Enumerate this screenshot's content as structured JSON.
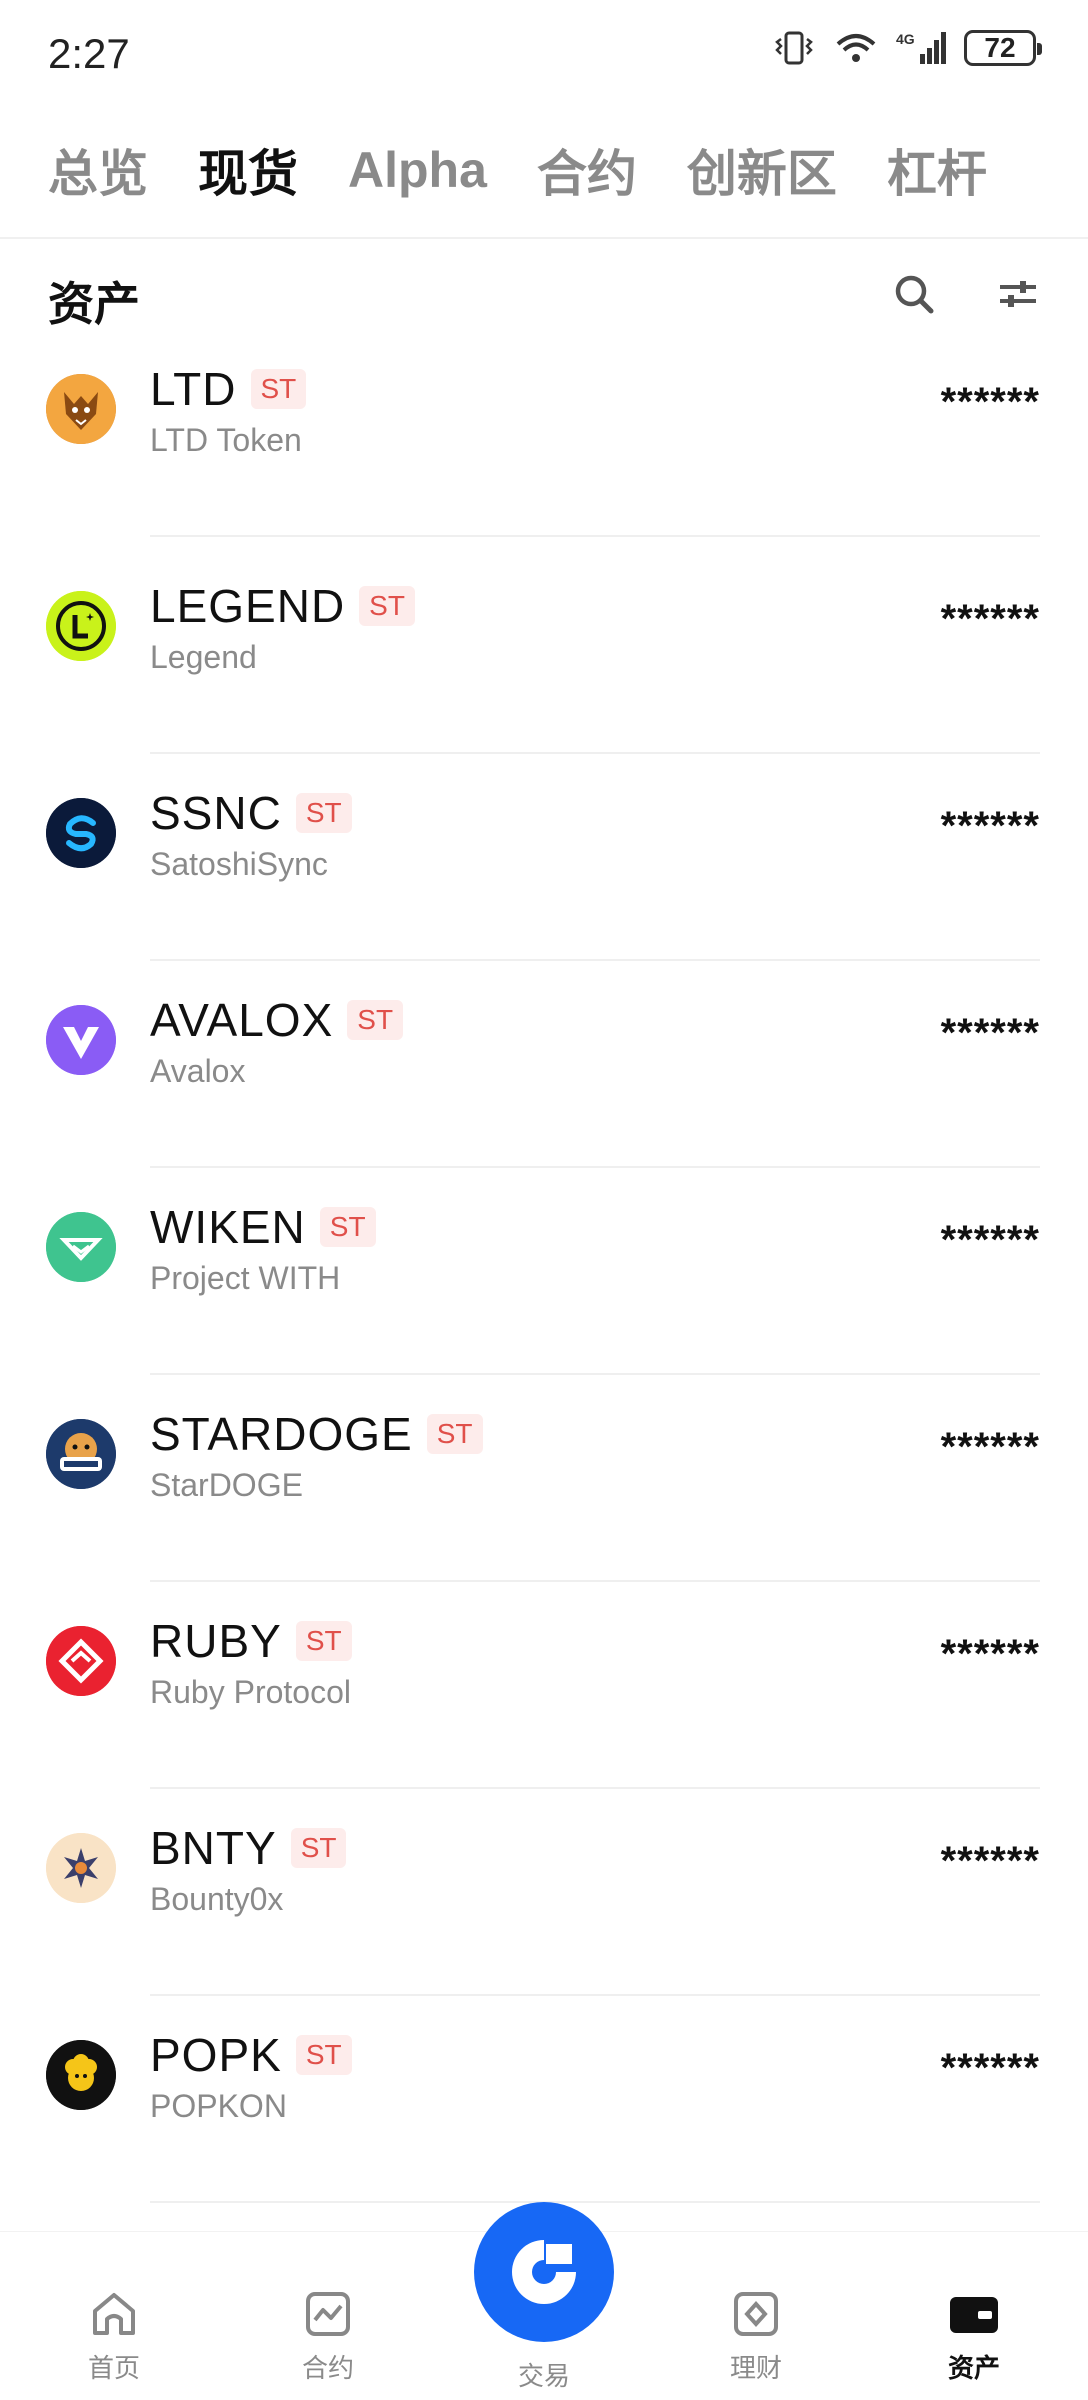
{
  "status_bar": {
    "time": "2:27",
    "battery": "72",
    "network": "4G"
  },
  "tabs": [
    {
      "label": "总览",
      "active": false
    },
    {
      "label": "现货",
      "active": true
    },
    {
      "label": "Alpha",
      "active": false
    },
    {
      "label": "合约",
      "active": false
    },
    {
      "label": "创新区",
      "active": false
    },
    {
      "label": "杠杆",
      "active": false
    }
  ],
  "section": {
    "title": "资产",
    "search_icon": "search-icon",
    "filter_icon": "sliders-icon"
  },
  "assets": [
    {
      "symbol": "LTD",
      "badge": "ST",
      "name": "LTD Token",
      "balance": "******",
      "logo_color": "#d9862b"
    },
    {
      "symbol": "LEGEND",
      "badge": "ST",
      "name": "Legend",
      "balance": "******",
      "logo_color": "#c9f21a"
    },
    {
      "symbol": "SSNC",
      "badge": "ST",
      "name": "SatoshiSync",
      "balance": "******",
      "logo_color": "#0b1a3a"
    },
    {
      "symbol": "AVALOX",
      "badge": "ST",
      "name": "Avalox",
      "balance": "******",
      "logo_color": "#8a5cf5"
    },
    {
      "symbol": "WIKEN",
      "badge": "ST",
      "name": "Project WITH",
      "balance": "******",
      "logo_color": "#3fc48f"
    },
    {
      "symbol": "STARDOGE",
      "badge": "ST",
      "name": "StarDOGE",
      "balance": "******",
      "logo_color": "#1d3a6b"
    },
    {
      "symbol": "RUBY",
      "badge": "ST",
      "name": "Ruby Protocol",
      "balance": "******",
      "logo_color": "#ea2230"
    },
    {
      "symbol": "BNTY",
      "badge": "ST",
      "name": "Bounty0x",
      "balance": "******",
      "logo_color": "#f9e3c6"
    },
    {
      "symbol": "POPK",
      "badge": "ST",
      "name": "POPKON",
      "balance": "******",
      "logo_color": "#111111"
    }
  ],
  "bottom_nav": {
    "home": "首页",
    "contract": "合约",
    "trade": "交易",
    "finance": "理财",
    "assets": "资产"
  },
  "colors": {
    "accent": "#1768f5",
    "badge_bg": "#fdeceb",
    "badge_text": "#e0504a"
  }
}
